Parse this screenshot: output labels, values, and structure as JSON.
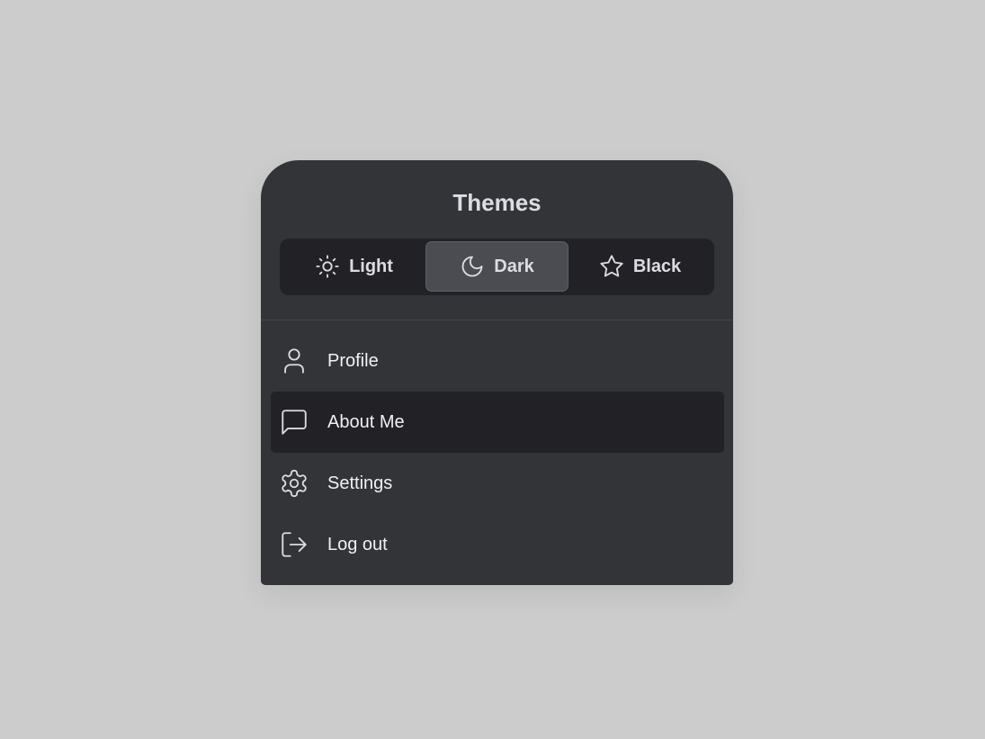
{
  "menu": {
    "title": "Themes",
    "themes": [
      {
        "label": "Light",
        "icon": "sun-icon",
        "active": false
      },
      {
        "label": "Dark",
        "icon": "moon-icon",
        "active": true
      },
      {
        "label": "Black",
        "icon": "star-icon",
        "active": false
      }
    ],
    "items": [
      {
        "label": "Profile",
        "icon": "user-icon"
      },
      {
        "label": "About Me",
        "icon": "message-square-icon",
        "highlighted": true
      },
      {
        "label": "Settings",
        "icon": "gear-icon"
      },
      {
        "label": "Log out",
        "icon": "log-out-icon"
      }
    ]
  },
  "colors": {
    "background": "#cccccc",
    "panel": "#333438",
    "segment_track": "#222226",
    "segment_active": "#4b4c51",
    "item_highlight": "#222226",
    "text": "#f1f1f4"
  }
}
